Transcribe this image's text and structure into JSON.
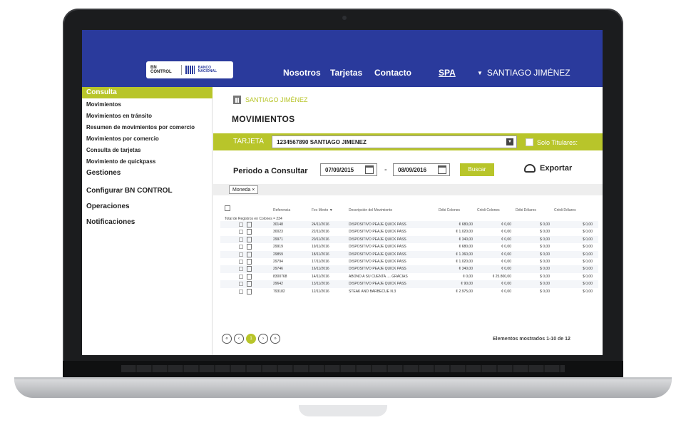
{
  "header": {
    "logo_left": "BN CONTROL",
    "logo_right": "BANCO NACIONAL",
    "nav": [
      "Nosotros",
      "Tarjetas",
      "Contacto",
      "SPA"
    ],
    "user": "SANTIAGO JIMÉNEZ"
  },
  "sidebar": {
    "active": "Consulta",
    "sub_items": [
      "Movimientos",
      "Movimientos en tránsito",
      "Resumen de movimientos por comercio",
      "Movimientos por comercio",
      "Consulta de tarjetas",
      "Movimiento de quickpass"
    ],
    "main_items": [
      "Gestiones",
      "Configurar BN CONTROL",
      "Operaciones",
      "Notificaciones"
    ]
  },
  "main": {
    "account_name": "SANTIAGO JIMÉNEZ",
    "title": "MOVIMIENTOS",
    "tarjeta_label": "TARJETA",
    "tarjeta_value": "1234567890 SANTIAGO JIMENEZ",
    "solo_titulares": "Solo Titulares:",
    "periodo_label": "Periodo a Consultar",
    "date_from": "07/09/2015",
    "date_sep": "-",
    "date_to": "08/09/2016",
    "buscar": "Buscar",
    "exportar": "Exportar",
    "filter_chip": "Moneda ×",
    "columns": [
      "Referencia",
      "Fec Movto ▼",
      "Descripción del Movimiento",
      "Débi Colones",
      "Crédi Colones",
      "Débi Dólares",
      "Crédi Dólares"
    ],
    "total_label": "Total de Registros en Colones = 234",
    "rows": [
      [
        "30148",
        "24/11/2016",
        "DISPOSITIVO PEAJE QUICK PASS",
        "¢ 680,00",
        "¢ 0,00",
        "$ 0,00",
        "$ 0,00"
      ],
      [
        "30023",
        "22/11/2016",
        "DISPOSITIVO PEAJE QUICK PASS",
        "¢ 1.020,00",
        "¢ 0,00",
        "$ 0,00",
        "$ 0,00"
      ],
      [
        "29971",
        "20/11/2016",
        "DISPOSITIVO PEAJE QUICK PASS",
        "¢ 340,00",
        "¢ 0,00",
        "$ 0,00",
        "$ 0,00"
      ],
      [
        "29919",
        "19/11/2016",
        "DISPOSITIVO PEAJE QUICK PASS",
        "¢ 680,00",
        "¢ 0,00",
        "$ 0,00",
        "$ 0,00"
      ],
      [
        "29859",
        "18/11/2016",
        "DISPOSITIVO PEAJE QUICK PASS",
        "¢ 1.360,00",
        "¢ 0,00",
        "$ 0,00",
        "$ 0,00"
      ],
      [
        "29794",
        "17/11/2016",
        "DISPOSITIVO PEAJE QUICK PASS",
        "¢ 1.020,00",
        "¢ 0,00",
        "$ 0,00",
        "$ 0,00"
      ],
      [
        "29746",
        "16/11/2016",
        "DISPOSITIVO PEAJE QUICK PASS",
        "¢ 340,00",
        "¢ 0,00",
        "$ 0,00",
        "$ 0,00"
      ],
      [
        "8300768",
        "14/11/2016",
        "ABONO A SU CUENTA .... GRACIAS",
        "¢ 0,00",
        "¢ 25.800,00",
        "$ 0,00",
        "$ 0,00"
      ],
      [
        "29642",
        "13/11/2016",
        "DISPOSITIVO PEAJE QUICK PASS",
        "¢ 90,00",
        "¢ 0,00",
        "$ 0,00",
        "$ 0,00"
      ],
      [
        "793182",
        "12/11/2016",
        "STEAK AND BARBECUE N.3",
        "¢ 2.975,00",
        "¢ 0,00",
        "$ 0,00",
        "$ 0,00"
      ]
    ],
    "pager": [
      "«",
      "‹",
      "1",
      "›",
      "»"
    ],
    "shown": "Elementos mostrados 1-10 de 12"
  },
  "colors": {
    "topbar": "#2a3a9c",
    "accent": "#b8c52a"
  }
}
